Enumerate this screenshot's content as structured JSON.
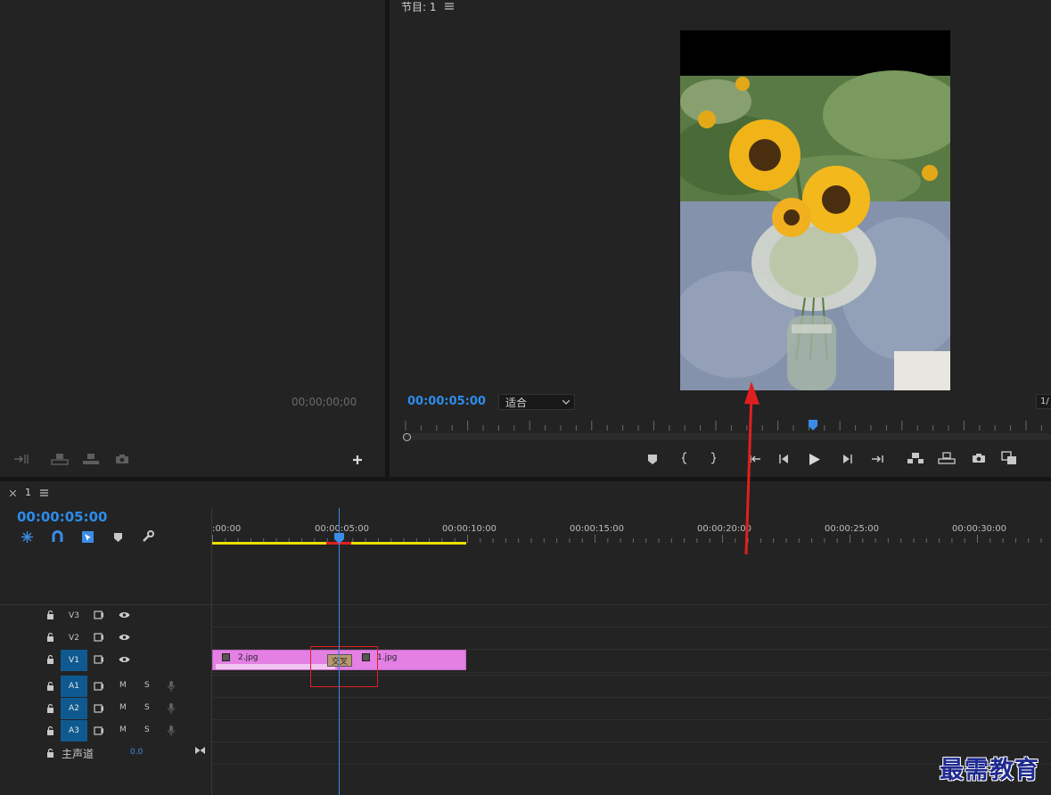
{
  "source_panel": {
    "timecode": "00;00;00;00"
  },
  "program_panel": {
    "title": "节目: 1",
    "timecode": "00:00:05:00",
    "fit_label": "适合",
    "page_fraction": "1/"
  },
  "timeline": {
    "tab_name": "1",
    "timecode": "00:00:05:00",
    "ruler_labels": [
      ":00:00",
      "00:00:05:00",
      "00:00:10:00",
      "00:00:15:00",
      "00:00:20:00",
      "00:00:25:00",
      "00:00:30:00"
    ],
    "video_tracks": [
      {
        "label": "V3",
        "active": false
      },
      {
        "label": "V2",
        "active": false
      },
      {
        "label": "V1",
        "active": true
      }
    ],
    "audio_tracks": [
      {
        "label": "A1",
        "m": "M",
        "s": "S"
      },
      {
        "label": "A2",
        "m": "M",
        "s": "S"
      },
      {
        "label": "A3",
        "m": "M",
        "s": "S"
      }
    ],
    "master": {
      "label": "主声道",
      "value": "0.0"
    },
    "clips": [
      {
        "name": "2.jpg",
        "color": "#e47fe4"
      },
      {
        "name": "1.jpg",
        "color": "#e47fe4"
      }
    ],
    "transition_label": "交叉"
  },
  "watermark": "最需教育",
  "colors": {
    "accent_blue": "#2d8ceb",
    "clip_pink": "#e47fe4",
    "active_track": "#0e5a90",
    "annotation_red": "#e02020",
    "workarea_yellow": "#e8e000"
  }
}
